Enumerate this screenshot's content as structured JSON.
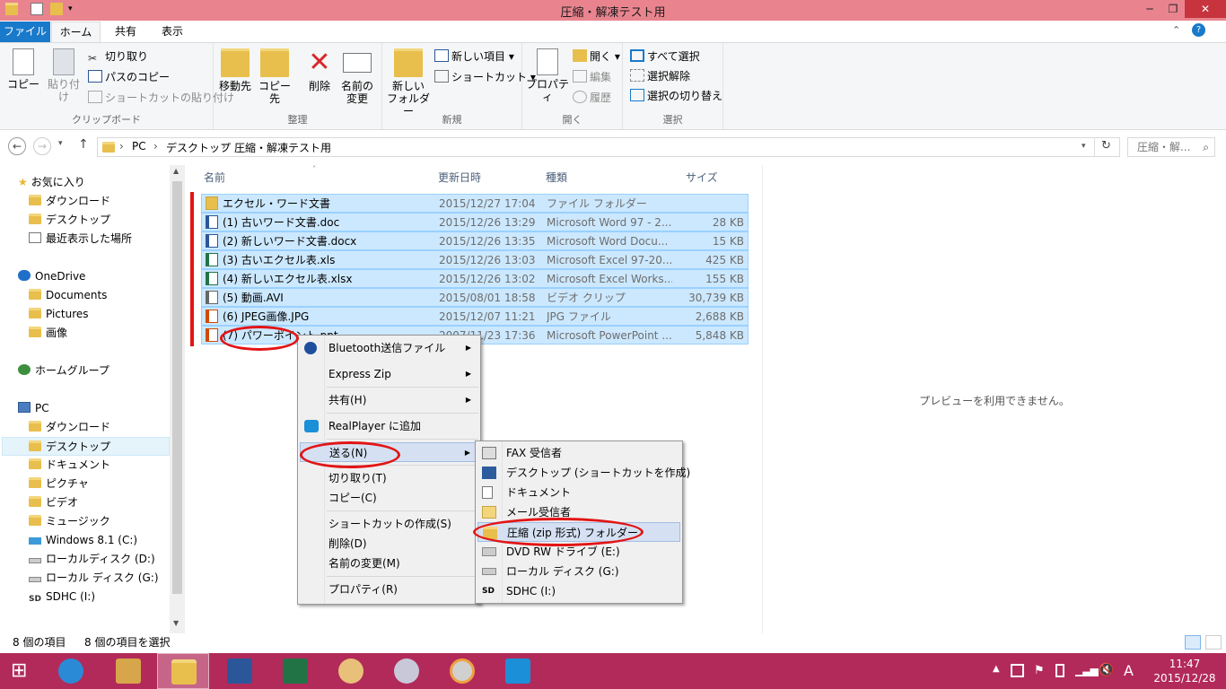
{
  "window": {
    "title": "圧縮・解凍テスト用",
    "controls": [
      "─",
      "❐",
      "✕"
    ]
  },
  "ribbon_tabs": [
    "ファイル",
    "ホーム",
    "共有",
    "表示"
  ],
  "ribbon": {
    "clipboard": {
      "copy": "コピー",
      "paste": "貼り付け",
      "cut": "切り取り",
      "copy_path": "パスのコピー",
      "paste_shortcut": "ショートカットの貼り付け",
      "label": "クリップボード"
    },
    "organize": {
      "move_to": "移動先",
      "copy_to": "コピー先",
      "delete": "削除",
      "rename_1": "名前の",
      "rename_2": "変更",
      "label": "整理"
    },
    "new": {
      "new_folder_1": "新しい",
      "new_folder_2": "フォルダー",
      "new_item": "新しい項目 ▾",
      "shortcut": "ショートカット ▾",
      "label": "新規"
    },
    "open": {
      "properties": "プロパティ",
      "open": "開く ▾",
      "edit": "編集",
      "history": "履歴",
      "label": "開く"
    },
    "select": {
      "select_all": "すべて選択",
      "select_none": "選択解除",
      "invert": "選択の切り替え",
      "label": "選択"
    }
  },
  "address": {
    "crumbs": [
      "PC",
      "デスクトップ",
      "圧縮・解凍テスト用"
    ],
    "search_placeholder": "圧縮・解...",
    "separator": "›"
  },
  "nav": {
    "favorites": "お気に入り",
    "downloads": "ダウンロード",
    "desktop": "デスクトップ",
    "recent": "最近表示した場所",
    "onedrive": "OneDrive",
    "documents": "Documents",
    "pictures": "Pictures",
    "images": "画像",
    "homegroup": "ホームグループ",
    "pc": "PC",
    "pc_downloads": "ダウンロード",
    "pc_desktop": "デスクトップ",
    "pc_documents": "ドキュメント",
    "pc_pictures": "ピクチャ",
    "pc_videos": "ビデオ",
    "pc_music": "ミュージック",
    "drive_c": "Windows 8.1 (C:)",
    "drive_d": "ローカルディスク (D:)",
    "drive_g": "ローカル ディスク (G:)",
    "drive_i": "SDHC (I:)"
  },
  "columns": {
    "name": "名前",
    "modified": "更新日時",
    "type": "種類",
    "size": "サイズ"
  },
  "files": [
    {
      "name": "エクセル・ワード文書",
      "date": "2015/12/27 17:04",
      "type": "ファイル フォルダー",
      "size": "",
      "icon": "folder-icon",
      "color": "#e8bf4c"
    },
    {
      "name": "(1) 古いワード文書.doc",
      "date": "2015/12/26 13:29",
      "type": "Microsoft Word 97 - 2...",
      "size": "28 KB",
      "icon": "word-file-icon",
      "color": "#2b579a"
    },
    {
      "name": "(2) 新しいワード文書.docx",
      "date": "2015/12/26 13:35",
      "type": "Microsoft Word Docu...",
      "size": "15 KB",
      "icon": "word-file-icon",
      "color": "#2b579a"
    },
    {
      "name": "(3) 古いエクセル表.xls",
      "date": "2015/12/26 13:03",
      "type": "Microsoft Excel 97-20...",
      "size": "425 KB",
      "icon": "excel-file-icon",
      "color": "#217346"
    },
    {
      "name": "(4) 新しいエクセル表.xlsx",
      "date": "2015/12/26 13:02",
      "type": "Microsoft Excel Works...",
      "size": "155 KB",
      "icon": "excel-file-icon",
      "color": "#217346"
    },
    {
      "name": "(5) 動画.AVI",
      "date": "2015/08/01 18:58",
      "type": "ビデオ クリップ",
      "size": "30,739 KB",
      "icon": "video-file-icon",
      "color": "#666666"
    },
    {
      "name": "(6)  JPEG画像.JPG",
      "date": "2015/12/07 11:21",
      "type": "JPG ファイル",
      "size": "2,688 KB",
      "icon": "image-file-icon",
      "color": "#d04a02"
    },
    {
      "name": "(7) パワーポイント.ppt",
      "date": "2007/11/23 17:36",
      "type": "Microsoft PowerPoint ...",
      "size": "5,848 KB",
      "icon": "powerpoint-file-icon",
      "color": "#d04a02"
    }
  ],
  "preview_message": "プレビューを利用できません。",
  "context_menu": {
    "bluetooth": "Bluetooth送信ファイル",
    "express_zip": "Express Zip",
    "share": "共有(H)",
    "realplayer": "RealPlayer に追加",
    "send_to": "送る(N)",
    "cut": "切り取り(T)",
    "copy": "コピー(C)",
    "create_shortcut": "ショートカットの作成(S)",
    "delete": "削除(D)",
    "rename": "名前の変更(M)",
    "properties": "プロパティ(R)",
    "arrow": "▶"
  },
  "sendto_menu": {
    "fax": "FAX 受信者",
    "desktop": "デスクトップ (ショートカットを作成)",
    "documents": "ドキュメント",
    "mail": "メール受信者",
    "zip": "圧縮 (zip 形式) フォルダー",
    "dvd": "DVD RW ドライブ (E:)",
    "local_g": "ローカル ディスク (G:)",
    "sdhc": "SDHC (I:)"
  },
  "status": {
    "count": "8 個の項目",
    "selected": "8 個の項目を選択"
  },
  "clock": {
    "time": "11:47",
    "date": "2015/12/28",
    "ime": "A"
  },
  "colors": {
    "titlebar": "#e9848f",
    "taskbar": "#b22a5a",
    "selection": "#cce8ff",
    "file_tab": "#1979ca",
    "annotation": "#e21515"
  }
}
